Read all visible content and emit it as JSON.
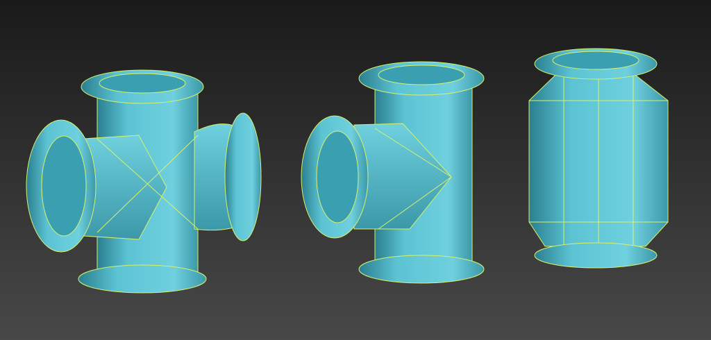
{
  "scene": {
    "objects": [
      "pipe-cross",
      "pipe-tee",
      "pipe-vessel"
    ],
    "colors": {
      "background_top": "#1a1a1a",
      "background_bottom": "#484848",
      "surface": "#5cc3d3",
      "surface_shade": "#2f8c9c",
      "inner": "#3a9fb0",
      "wire": "#d8f26a"
    }
  }
}
